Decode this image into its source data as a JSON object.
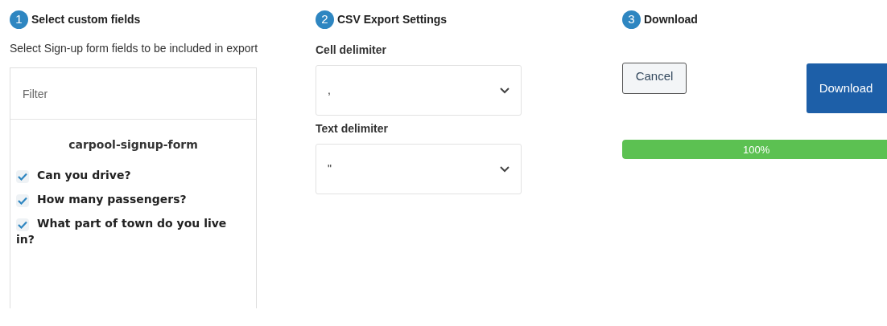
{
  "steps": [
    {
      "number": "1",
      "title": "Select custom fields"
    },
    {
      "number": "2",
      "title": "CSV Export Settings"
    },
    {
      "number": "3",
      "title": "Download"
    }
  ],
  "fields": {
    "description": "Select Sign-up form fields to be included in export",
    "filter": {
      "placeholder": "Filter"
    },
    "form_name": "carpool-signup-form",
    "items": [
      {
        "label": "Can you drive?",
        "checked": true
      },
      {
        "label": "How many passengers?",
        "checked": true
      },
      {
        "label": "What part of town do you live in?",
        "checked": true
      }
    ]
  },
  "csv": {
    "selects": [
      {
        "label": "Cell delimiter",
        "value": ","
      },
      {
        "label": "Text delimiter",
        "value": "\""
      }
    ]
  },
  "download": {
    "cancel": "Cancel",
    "download": "Download",
    "progress": {
      "level": 1,
      "reading": "100%"
    }
  }
}
